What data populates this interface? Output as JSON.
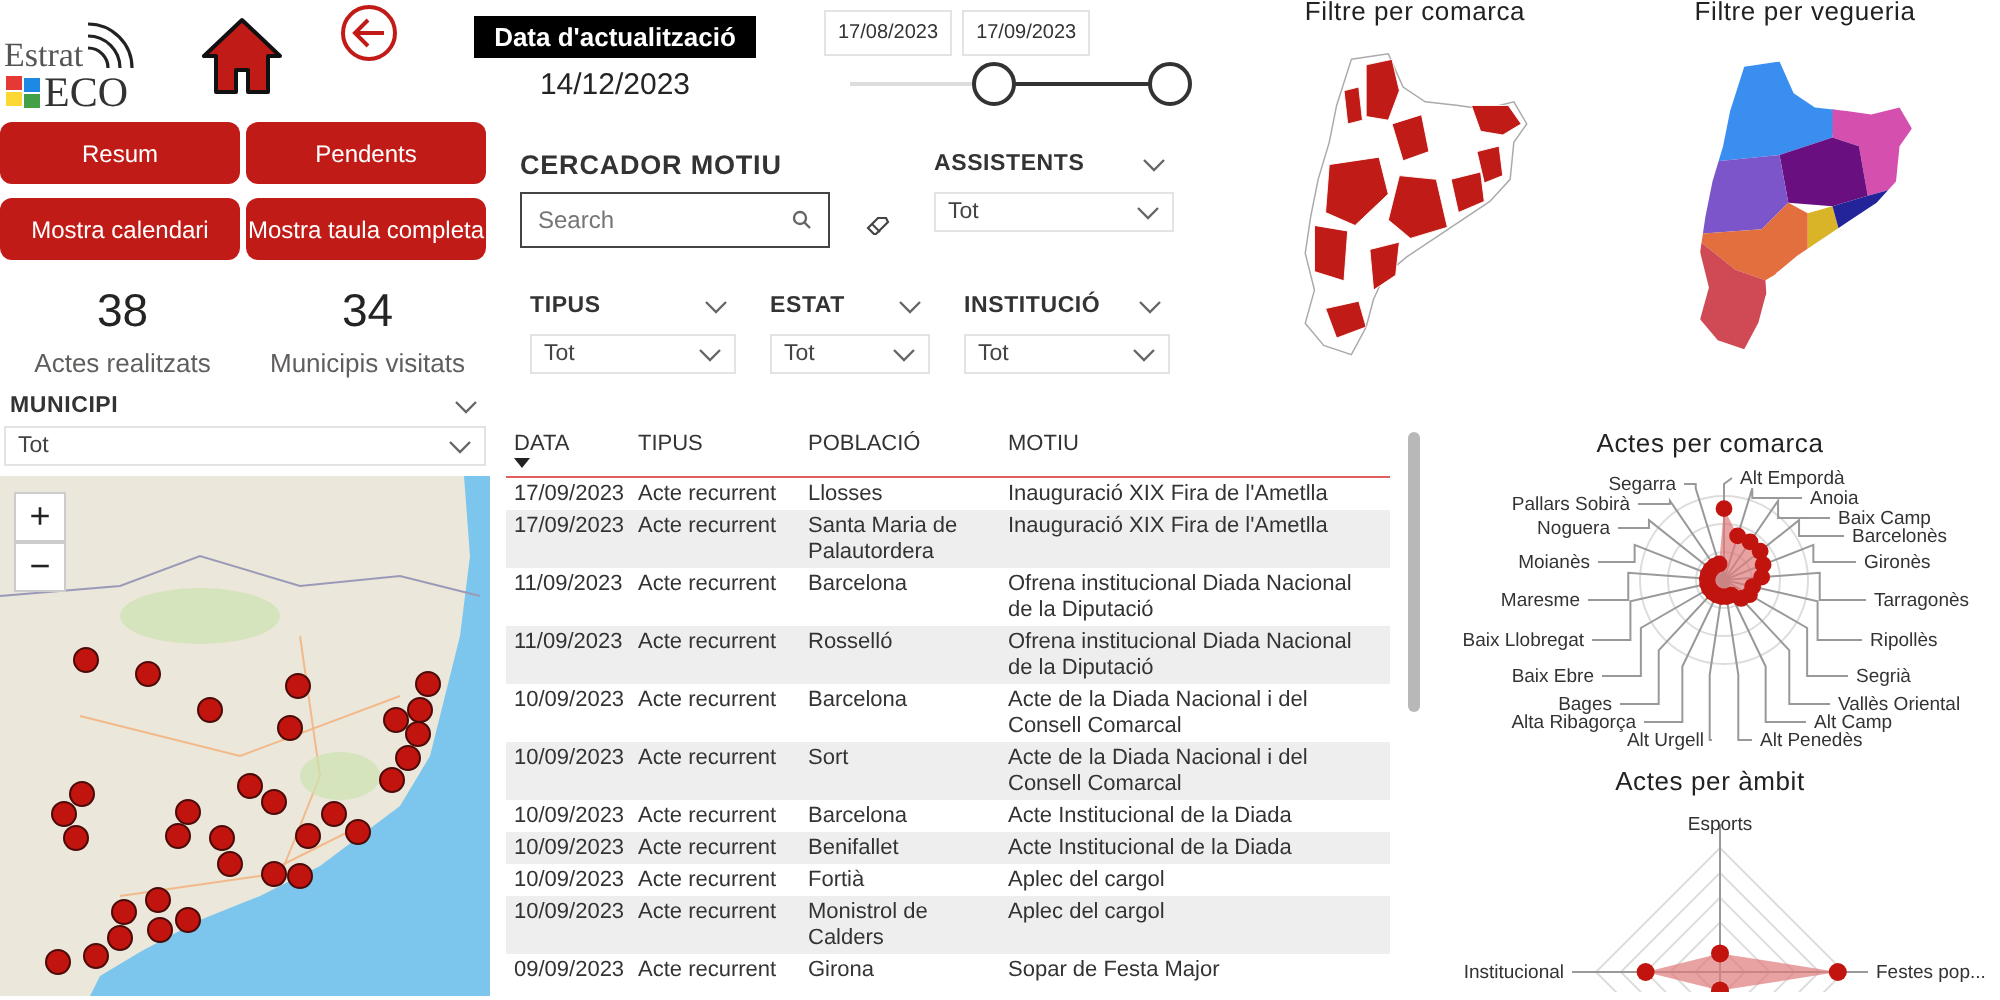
{
  "header": {
    "logo": {
      "line1": "Estrat",
      "line2": "ECO"
    },
    "update_label": "Data d'actualització",
    "update_date": "14/12/2023"
  },
  "buttons": [
    "Resum",
    "Pendents",
    "Mostra calendari",
    "Mostra taula completa"
  ],
  "kpis": [
    {
      "value": "38",
      "label": "Actes realitzats"
    },
    {
      "value": "34",
      "label": "Municipis visitats"
    }
  ],
  "municipi": {
    "label": "MUNICIPI",
    "value": "Tot"
  },
  "map": {
    "zoom_in": "+",
    "zoom_out": "−"
  },
  "date_range": {
    "start": "17/08/2023",
    "end": "17/09/2023",
    "thumbs": [
      {
        "level": 0.45
      },
      {
        "level": 1
      }
    ]
  },
  "search": {
    "label": "CERCADOR MOTIU",
    "placeholder": "Search"
  },
  "slicers": [
    {
      "label": "ASSISTENTS",
      "value": "Tot"
    },
    {
      "label": "TIPUS",
      "value": "Tot"
    },
    {
      "label": "ESTAT",
      "value": "Tot"
    },
    {
      "label": "INSTITUCIÓ",
      "value": "Tot"
    }
  ],
  "maps": [
    {
      "title": "Filtre per comarca",
      "kind": "comarca"
    },
    {
      "title": "Filtre per vegueria",
      "kind": "vegueria"
    }
  ],
  "table": {
    "columns": [
      {
        "label": "DATA",
        "sorted": true
      },
      {
        "label": "TIPUS",
        "sorted": false
      },
      {
        "label": "POBLACIÓ",
        "sorted": false
      },
      {
        "label": "MOTIU",
        "sorted": false
      }
    ],
    "rows": [
      [
        "17/09/2023",
        "Acte recurrent",
        "Llosses",
        "Inauguració XIX Fira de l'Ametlla"
      ],
      [
        "17/09/2023",
        "Acte recurrent",
        "Santa Maria de Palautordera",
        "Inauguració XIX Fira de l'Ametlla"
      ],
      [
        "11/09/2023",
        "Acte recurrent",
        "Barcelona",
        "Ofrena institucional Diada Nacional de la Diputació"
      ],
      [
        "11/09/2023",
        "Acte recurrent",
        "Rosselló",
        "Ofrena institucional Diada Nacional de la Diputació"
      ],
      [
        "10/09/2023",
        "Acte recurrent",
        "Barcelona",
        "Acte de la Diada Nacional i del Consell Comarcal"
      ],
      [
        "10/09/2023",
        "Acte recurrent",
        "Sort",
        "Acte de la Diada Nacional i del Consell Comarcal"
      ],
      [
        "10/09/2023",
        "Acte recurrent",
        "Barcelona",
        "Acte Institucional de la Diada"
      ],
      [
        "10/09/2023",
        "Acte recurrent",
        "Benifallet",
        "Acte Institucional de la Diada"
      ],
      [
        "10/09/2023",
        "Acte recurrent",
        "Fortià",
        "Aplec del cargol"
      ],
      [
        "10/09/2023",
        "Acte recurrent",
        "Monistrol de Calders",
        "Aplec del cargol"
      ],
      [
        "09/09/2023",
        "Acte recurrent",
        "Girona",
        "Sopar de Festa Major"
      ]
    ]
  },
  "charts": [
    {
      "title": "Actes per comarca",
      "kind": "comarca",
      "labels": [
        "Alt Empordà",
        "Anoia",
        "Baix Camp",
        "Barcelonès",
        "Gironès",
        "Tarragonès",
        "Ripollès",
        "Segrià",
        "Vallès Oriental",
        "Alt Camp",
        "Alt Penedès",
        "Segarra",
        "Pallars Sobirà",
        "Noguera",
        "Moianès",
        "Maresme",
        "Baix Llobregat",
        "Baix Ebre",
        "Bages",
        "Alta Ribagorça",
        "Alt Urgell"
      ]
    },
    {
      "title": "Actes per àmbit",
      "kind": "ambit",
      "labels": [
        "Esports",
        "Festes pop...",
        "Institucional"
      ]
    }
  ]
}
